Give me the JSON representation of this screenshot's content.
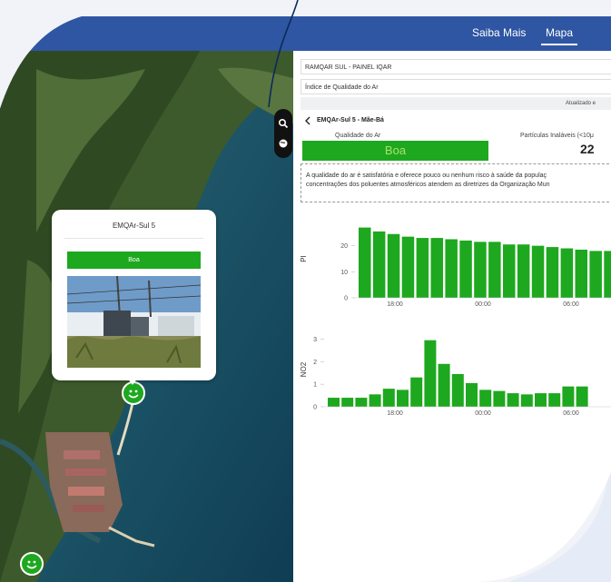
{
  "header": {
    "nav": [
      {
        "label": "Saiba Mais"
      },
      {
        "label": "Mapa"
      }
    ]
  },
  "map": {
    "popup": {
      "title": "EMQAr-Sul 5",
      "status": "Boa"
    }
  },
  "panel": {
    "field1": "RAMQAR SUL - PAINEL IQAR",
    "field2": "Índice de Qualidade do Ar",
    "updated": "Atualizado e",
    "back_icon": "chevron-left-icon",
    "station": "EMQAr-Sul 5 - Mãe-Bá",
    "aq_label": "Qualidade do Ar",
    "aq_value": "Boa",
    "pi_label": "Partículas Inaláveis (<10μ",
    "pi_value": "22",
    "description_line1": "A qualidade do ar é satisfatória e oferece pouco ou nenhum risco à saúde da populaç",
    "description_line2": "concentrações dos poluentes atmosféricos atendem as diretrizes da Organização Mun"
  },
  "colors": {
    "header": "#2f56a3",
    "good": "#1ea81f"
  },
  "chart_data": [
    {
      "type": "bar",
      "ylabel": "PI",
      "ylim": [
        0,
        30
      ],
      "yticks": [
        0,
        10,
        20
      ],
      "xticks": [
        "18:00",
        "00:00",
        "06:00"
      ],
      "values": [
        27,
        25.5,
        24.5,
        23.5,
        23,
        23,
        22.5,
        22,
        21.5,
        21.5,
        20.5,
        20.5,
        20,
        19.5,
        19,
        18.5,
        18,
        18
      ]
    },
    {
      "type": "bar",
      "ylabel": "NO2",
      "ylim": [
        0,
        3.3
      ],
      "yticks": [
        0,
        1,
        2,
        3
      ],
      "xticks": [
        "18:00",
        "00:00",
        "06:00"
      ],
      "values": [
        0.4,
        0.4,
        0.4,
        0.55,
        0.8,
        0.75,
        1.3,
        2.95,
        1.9,
        1.45,
        1.05,
        0.75,
        0.7,
        0.6,
        0.55,
        0.6,
        0.6,
        0.9,
        0.9
      ]
    }
  ]
}
